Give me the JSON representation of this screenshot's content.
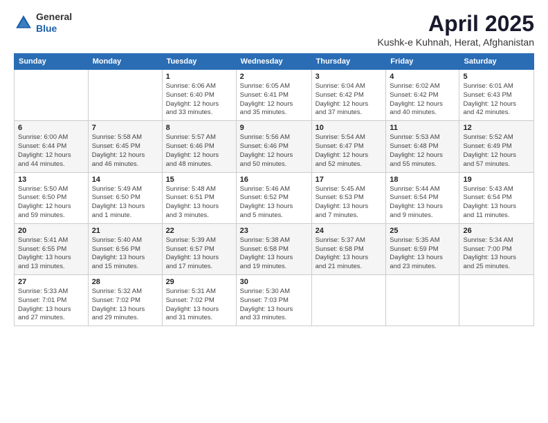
{
  "header": {
    "logo_line1": "General",
    "logo_line2": "Blue",
    "title": "April 2025",
    "subtitle": "Kushk-e Kuhnah, Herat, Afghanistan"
  },
  "calendar": {
    "days_of_week": [
      "Sunday",
      "Monday",
      "Tuesday",
      "Wednesday",
      "Thursday",
      "Friday",
      "Saturday"
    ],
    "weeks": [
      [
        {
          "day": "",
          "info": ""
        },
        {
          "day": "",
          "info": ""
        },
        {
          "day": "1",
          "info": "Sunrise: 6:06 AM\nSunset: 6:40 PM\nDaylight: 12 hours\nand 33 minutes."
        },
        {
          "day": "2",
          "info": "Sunrise: 6:05 AM\nSunset: 6:41 PM\nDaylight: 12 hours\nand 35 minutes."
        },
        {
          "day": "3",
          "info": "Sunrise: 6:04 AM\nSunset: 6:42 PM\nDaylight: 12 hours\nand 37 minutes."
        },
        {
          "day": "4",
          "info": "Sunrise: 6:02 AM\nSunset: 6:42 PM\nDaylight: 12 hours\nand 40 minutes."
        },
        {
          "day": "5",
          "info": "Sunrise: 6:01 AM\nSunset: 6:43 PM\nDaylight: 12 hours\nand 42 minutes."
        }
      ],
      [
        {
          "day": "6",
          "info": "Sunrise: 6:00 AM\nSunset: 6:44 PM\nDaylight: 12 hours\nand 44 minutes."
        },
        {
          "day": "7",
          "info": "Sunrise: 5:58 AM\nSunset: 6:45 PM\nDaylight: 12 hours\nand 46 minutes."
        },
        {
          "day": "8",
          "info": "Sunrise: 5:57 AM\nSunset: 6:46 PM\nDaylight: 12 hours\nand 48 minutes."
        },
        {
          "day": "9",
          "info": "Sunrise: 5:56 AM\nSunset: 6:46 PM\nDaylight: 12 hours\nand 50 minutes."
        },
        {
          "day": "10",
          "info": "Sunrise: 5:54 AM\nSunset: 6:47 PM\nDaylight: 12 hours\nand 52 minutes."
        },
        {
          "day": "11",
          "info": "Sunrise: 5:53 AM\nSunset: 6:48 PM\nDaylight: 12 hours\nand 55 minutes."
        },
        {
          "day": "12",
          "info": "Sunrise: 5:52 AM\nSunset: 6:49 PM\nDaylight: 12 hours\nand 57 minutes."
        }
      ],
      [
        {
          "day": "13",
          "info": "Sunrise: 5:50 AM\nSunset: 6:50 PM\nDaylight: 12 hours\nand 59 minutes."
        },
        {
          "day": "14",
          "info": "Sunrise: 5:49 AM\nSunset: 6:50 PM\nDaylight: 13 hours\nand 1 minute."
        },
        {
          "day": "15",
          "info": "Sunrise: 5:48 AM\nSunset: 6:51 PM\nDaylight: 13 hours\nand 3 minutes."
        },
        {
          "day": "16",
          "info": "Sunrise: 5:46 AM\nSunset: 6:52 PM\nDaylight: 13 hours\nand 5 minutes."
        },
        {
          "day": "17",
          "info": "Sunrise: 5:45 AM\nSunset: 6:53 PM\nDaylight: 13 hours\nand 7 minutes."
        },
        {
          "day": "18",
          "info": "Sunrise: 5:44 AM\nSunset: 6:54 PM\nDaylight: 13 hours\nand 9 minutes."
        },
        {
          "day": "19",
          "info": "Sunrise: 5:43 AM\nSunset: 6:54 PM\nDaylight: 13 hours\nand 11 minutes."
        }
      ],
      [
        {
          "day": "20",
          "info": "Sunrise: 5:41 AM\nSunset: 6:55 PM\nDaylight: 13 hours\nand 13 minutes."
        },
        {
          "day": "21",
          "info": "Sunrise: 5:40 AM\nSunset: 6:56 PM\nDaylight: 13 hours\nand 15 minutes."
        },
        {
          "day": "22",
          "info": "Sunrise: 5:39 AM\nSunset: 6:57 PM\nDaylight: 13 hours\nand 17 minutes."
        },
        {
          "day": "23",
          "info": "Sunrise: 5:38 AM\nSunset: 6:58 PM\nDaylight: 13 hours\nand 19 minutes."
        },
        {
          "day": "24",
          "info": "Sunrise: 5:37 AM\nSunset: 6:58 PM\nDaylight: 13 hours\nand 21 minutes."
        },
        {
          "day": "25",
          "info": "Sunrise: 5:35 AM\nSunset: 6:59 PM\nDaylight: 13 hours\nand 23 minutes."
        },
        {
          "day": "26",
          "info": "Sunrise: 5:34 AM\nSunset: 7:00 PM\nDaylight: 13 hours\nand 25 minutes."
        }
      ],
      [
        {
          "day": "27",
          "info": "Sunrise: 5:33 AM\nSunset: 7:01 PM\nDaylight: 13 hours\nand 27 minutes."
        },
        {
          "day": "28",
          "info": "Sunrise: 5:32 AM\nSunset: 7:02 PM\nDaylight: 13 hours\nand 29 minutes."
        },
        {
          "day": "29",
          "info": "Sunrise: 5:31 AM\nSunset: 7:02 PM\nDaylight: 13 hours\nand 31 minutes."
        },
        {
          "day": "30",
          "info": "Sunrise: 5:30 AM\nSunset: 7:03 PM\nDaylight: 13 hours\nand 33 minutes."
        },
        {
          "day": "",
          "info": ""
        },
        {
          "day": "",
          "info": ""
        },
        {
          "day": "",
          "info": ""
        }
      ]
    ]
  }
}
